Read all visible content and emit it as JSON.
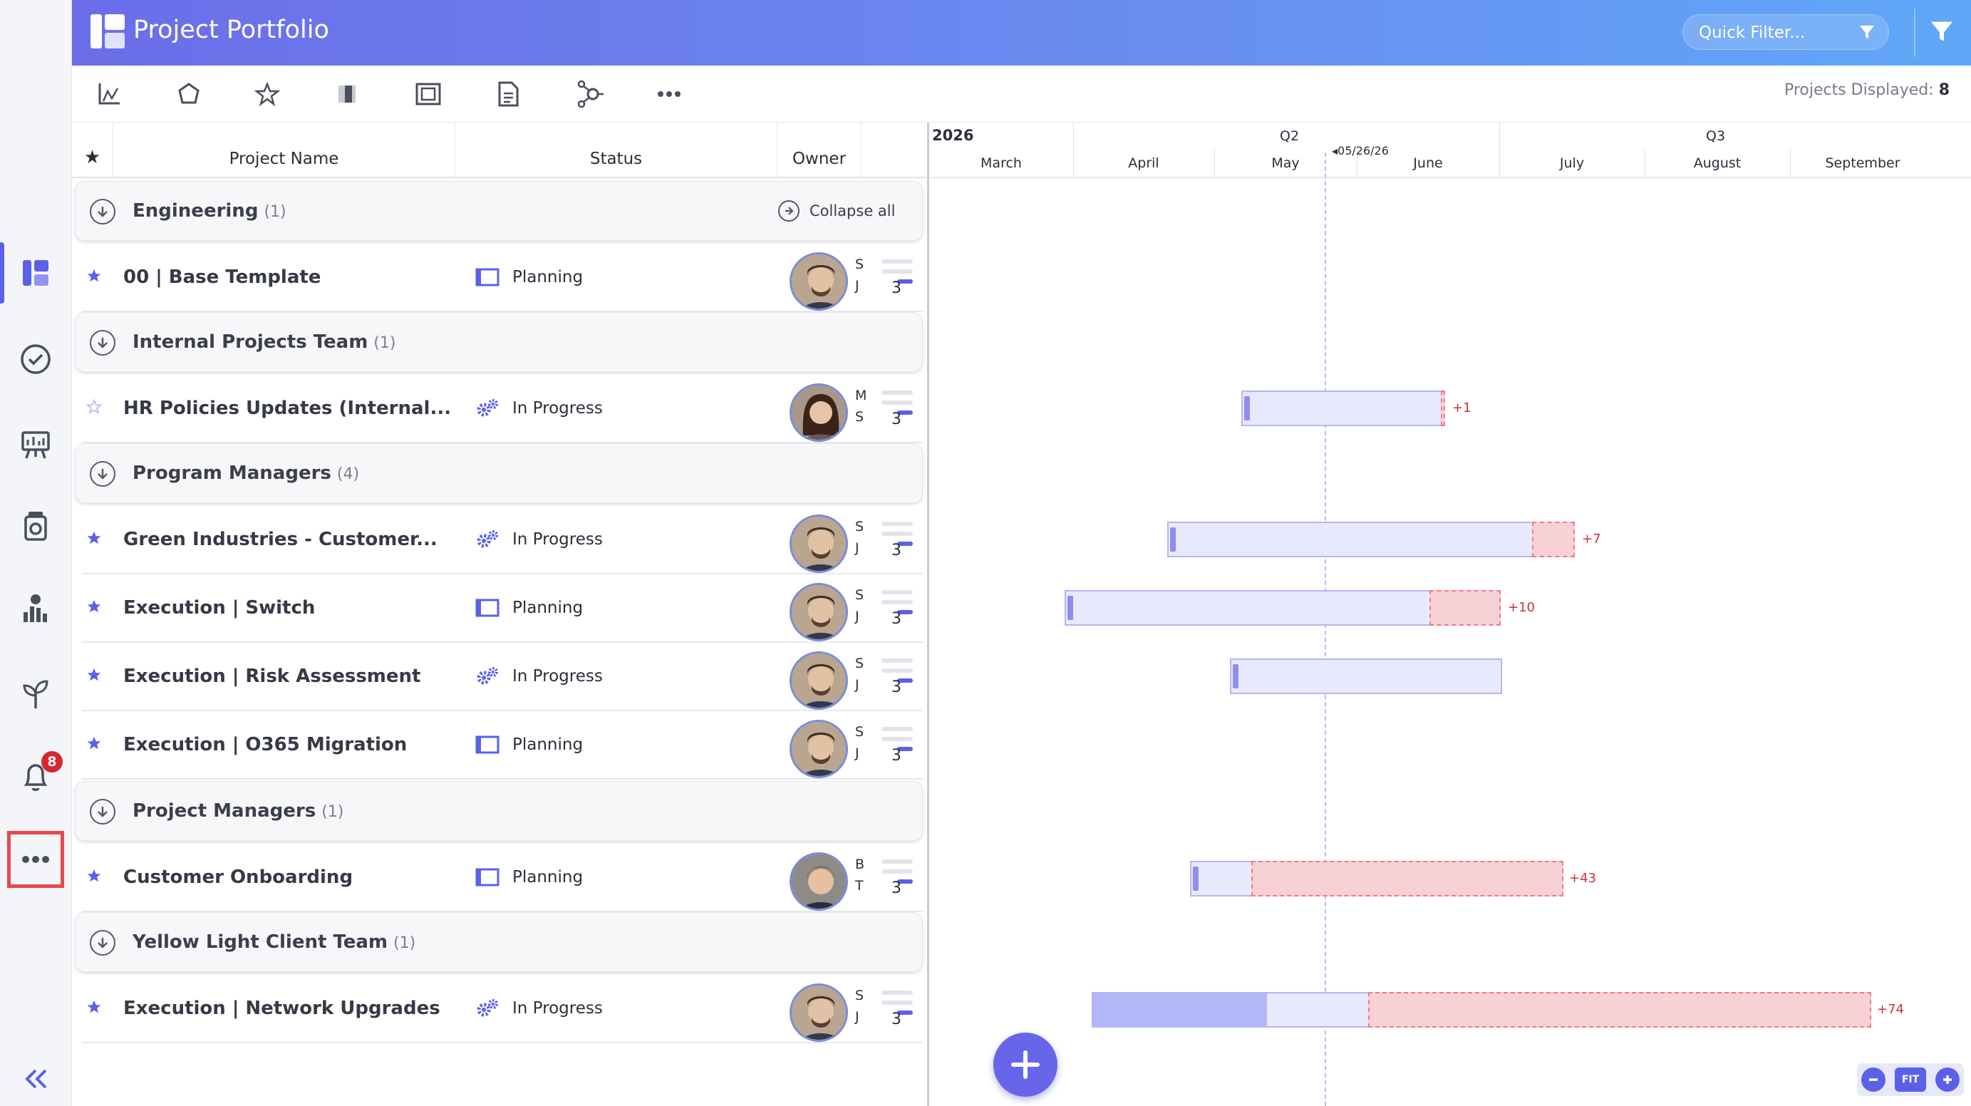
{
  "app": {
    "title": "Project Portfolio"
  },
  "header": {
    "quick_filter_placeholder": "Quick Filter...",
    "filter_icon": "funnel-icon"
  },
  "toolbar": {
    "tools": [
      "axis-chart-icon",
      "shape-icon",
      "star-icon",
      "column-icon",
      "frame-icon",
      "document-icon",
      "workflow-icon",
      "more-icon"
    ],
    "projects_displayed_label": "Projects Displayed:",
    "projects_displayed_value": "8"
  },
  "sidebar": {
    "items": [
      "portfolio-icon",
      "check-circle-icon",
      "presentation-icon",
      "camera-jar-icon",
      "people-chart-icon",
      "sprout-icon",
      "bell-icon",
      "more-icon",
      "collapse-sidebar-icon"
    ],
    "notification_count": "8"
  },
  "grid": {
    "columns": {
      "star": "★",
      "name": "Project Name",
      "status": "Status",
      "owner": "Owner"
    },
    "collapse_all": "Collapse all",
    "groups": [
      {
        "name": "Engineering",
        "count": "(1)"
      },
      {
        "name": "Internal Projects Team",
        "count": "(1)"
      },
      {
        "name": "Program Managers",
        "count": "(4)"
      },
      {
        "name": "Project Managers",
        "count": "(1)"
      },
      {
        "name": "Yellow Light Client Team",
        "count": "(1)"
      }
    ],
    "projects": [
      {
        "name": "00 | Base Template",
        "status": "Planning",
        "initials": [
          "S",
          "J"
        ],
        "priority": "3",
        "starred": true
      },
      {
        "name": "HR Policies Updates (Internal...",
        "status": "In Progress",
        "initials": [
          "M",
          "S"
        ],
        "priority": "3",
        "starred": false
      },
      {
        "name": "Green Industries - Customer...",
        "status": "In Progress",
        "initials": [
          "S",
          "J"
        ],
        "priority": "3",
        "starred": true
      },
      {
        "name": "Execution | Switch",
        "status": "Planning",
        "initials": [
          "S",
          "J"
        ],
        "priority": "3",
        "starred": true
      },
      {
        "name": "Execution | Risk Assessment",
        "status": "In Progress",
        "initials": [
          "S",
          "J"
        ],
        "priority": "3",
        "starred": true
      },
      {
        "name": "Execution | O365 Migration",
        "status": "Planning",
        "initials": [
          "S",
          "J"
        ],
        "priority": "3",
        "starred": true
      },
      {
        "name": "Customer Onboarding",
        "status": "Planning",
        "initials": [
          "B",
          "T"
        ],
        "priority": "3",
        "starred": true
      },
      {
        "name": "Execution | Network Upgrades",
        "status": "In Progress",
        "initials": [
          "S",
          "J"
        ],
        "priority": "3",
        "starred": true
      }
    ]
  },
  "gantt": {
    "year": "2026",
    "quarters": [
      "Q2",
      "Q3"
    ],
    "months": [
      "March",
      "April",
      "May",
      "June",
      "July",
      "August",
      "September"
    ],
    "today": "05/26/26",
    "overruns": [
      "+1",
      "+7",
      "+10",
      "+43",
      "+74"
    ]
  },
  "zoom": {
    "fit_label": "FIT"
  },
  "colors": {
    "accent": "#5a61e8",
    "over": "#f7d1d6",
    "bar": "#e9e9fd"
  }
}
